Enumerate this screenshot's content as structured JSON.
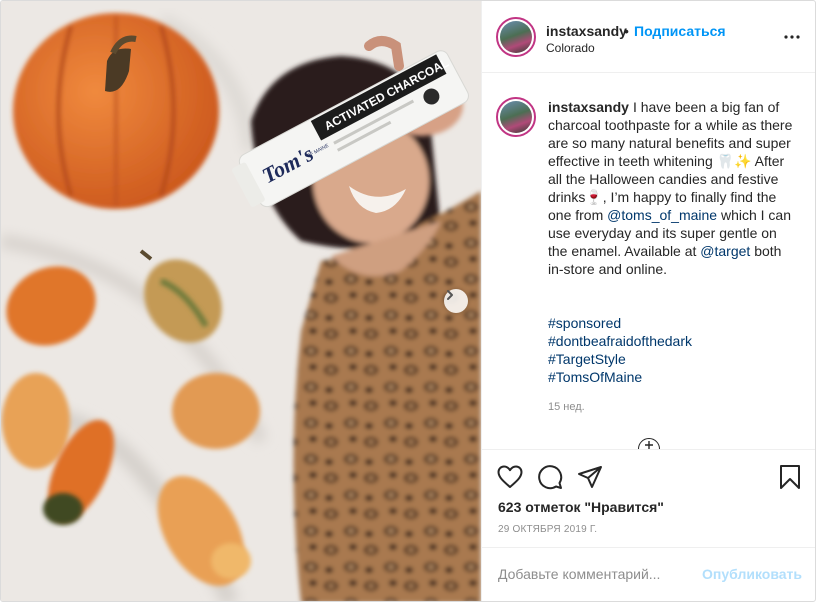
{
  "post": {
    "author": "instaxsandy",
    "follow_label": "Подписаться",
    "separator": "•",
    "location": "Colorado",
    "product_brand": "Tom's",
    "product_sub": "OF MAINE",
    "product_label": "ACTIVATED CHARCOAL"
  },
  "caption": {
    "author": "instaxsandy",
    "text_1": "I have been a big fan of charcoal toothpaste for a while as there are so many natural benefits and super effective in teeth whitening 🦷✨ After all the Halloween candies and festive drinks🍷, I’m happy to finally find the one from ",
    "mention_1": "@toms_of_maine",
    "text_2": " which I can use everyday and its super gentle on the enamel. Available at ",
    "mention_2": "@target",
    "text_3": " both in-store and online.",
    "hashtags": [
      "#sponsored",
      "#dontbeafraidofthedark",
      "#TargetStyle",
      "#TomsOfMaine"
    ],
    "time_ago": "15 нед."
  },
  "actions": {
    "likes": "623 отметок \"Нравится\"",
    "date": "29 ОКТЯБРЯ 2019 Г."
  },
  "comment_box": {
    "placeholder": "Добавьте комментарий...",
    "publish_label": "Опубликовать"
  },
  "icons": {
    "more": "more-options-icon",
    "like": "heart-icon",
    "comment": "comment-icon",
    "share": "paper-plane-icon",
    "save": "bookmark-icon",
    "next": "chevron-right-icon",
    "load": "plus-circle-icon"
  },
  "colors": {
    "link": "#00376b",
    "follow": "#0095f6",
    "publish_disabled": "#b2dffc",
    "muted": "#8e8e8e"
  }
}
